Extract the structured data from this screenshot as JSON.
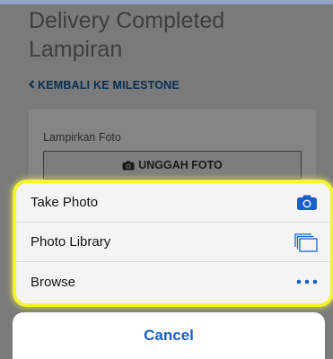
{
  "header": {
    "title_line1": "Delivery Completed",
    "title_line2": "Lampiran",
    "back_link": "KEMBALI KE MILESTONE"
  },
  "attachment": {
    "label": "Lampirkan Foto",
    "upload_button": "UNGGAH FOTO"
  },
  "action_sheet": {
    "options": [
      {
        "label": "Take Photo",
        "icon": "camera-icon"
      },
      {
        "label": "Photo Library",
        "icon": "photo-library-icon"
      },
      {
        "label": "Browse",
        "icon": "more-dots-icon"
      }
    ],
    "cancel_label": "Cancel"
  },
  "colors": {
    "accent_blue": "#1a5fc8",
    "highlight_yellow": "#f3f330",
    "link_navy": "#0b2d52"
  }
}
